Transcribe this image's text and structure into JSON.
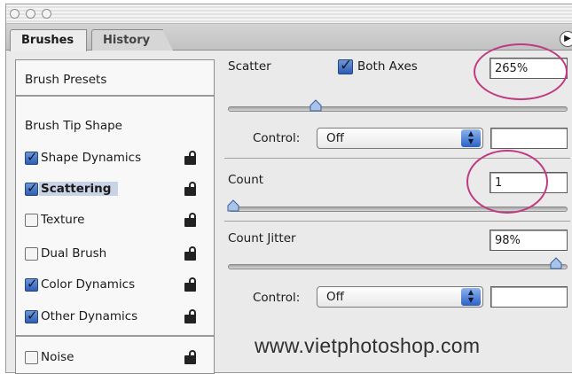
{
  "tabs": {
    "brushes": "Brushes",
    "history": "History"
  },
  "left": {
    "presets": "Brush Presets",
    "tip_shape": "Brush Tip Shape",
    "items": [
      {
        "label": "Shape Dynamics",
        "checked": true
      },
      {
        "label": "Scattering",
        "checked": true,
        "selected": true
      },
      {
        "label": "Texture",
        "checked": false
      },
      {
        "label": "Dual Brush",
        "checked": false
      },
      {
        "label": "Color Dynamics",
        "checked": true
      },
      {
        "label": "Other Dynamics",
        "checked": true
      },
      {
        "label": "Noise",
        "checked": false
      }
    ]
  },
  "scatter": {
    "label": "Scatter",
    "both_axes_label": "Both Axes",
    "both_axes_checked": true,
    "value": "265%",
    "slider_fraction": 0.25,
    "control_label": "Control:",
    "control_value": "Off"
  },
  "count": {
    "label": "Count",
    "value": "1",
    "slider_fraction": 0.0
  },
  "count_jitter": {
    "label": "Count Jitter",
    "value": "98%",
    "slider_fraction": 0.98,
    "control_label": "Control:",
    "control_value": "Off"
  },
  "watermark": "www.vietphotoshop.com",
  "colors": {
    "highlight_circle": "#c03a82",
    "selection": "#c9d3e6",
    "checkbox_blue": "#2e5db4"
  }
}
